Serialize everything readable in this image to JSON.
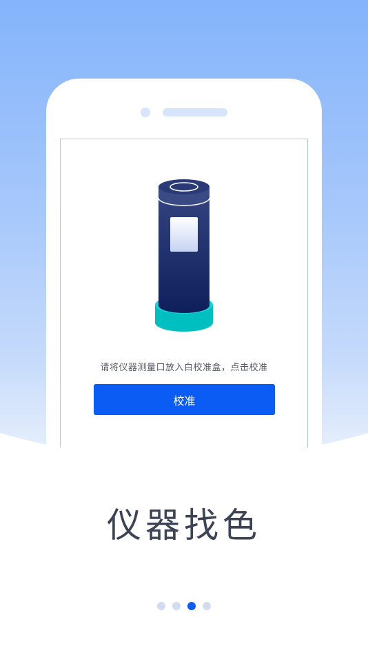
{
  "onboarding": {
    "instruction": "请将仪器测量口放入白校准盒，点击校准",
    "calibrate_label": "校准",
    "title": "仪器找色",
    "pages": 4,
    "current_page": 3
  },
  "colors": {
    "accent": "#0a5cf5",
    "cylinder_top": "#2f3f7c",
    "cylinder_base": "#00c5c5",
    "title_text": "#3b4354"
  },
  "illustration": {
    "icon": "colorimeter-device-icon"
  }
}
